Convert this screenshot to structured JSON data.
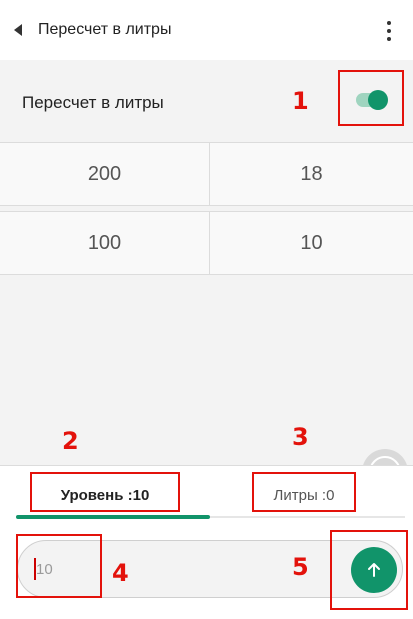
{
  "appbar": {
    "title": "Пересчет в литры",
    "more_icon": "more-vert-icon",
    "back_icon": "back-arrow-icon"
  },
  "settings": {
    "toggle_label": "Пересчет в литры",
    "toggle_on": true,
    "accent": "#11946a"
  },
  "table": {
    "rows": [
      [
        "200",
        "18"
      ],
      [
        "100",
        "10"
      ]
    ]
  },
  "tabs": [
    {
      "label": "Уровень :10",
      "selected": true
    },
    {
      "label": "Литры :0",
      "selected": false
    }
  ],
  "input": {
    "value": "",
    "placeholder": "10"
  },
  "annotations": [
    "1",
    "2",
    "3",
    "4",
    "5"
  ],
  "annotation_color": "#e3120b"
}
